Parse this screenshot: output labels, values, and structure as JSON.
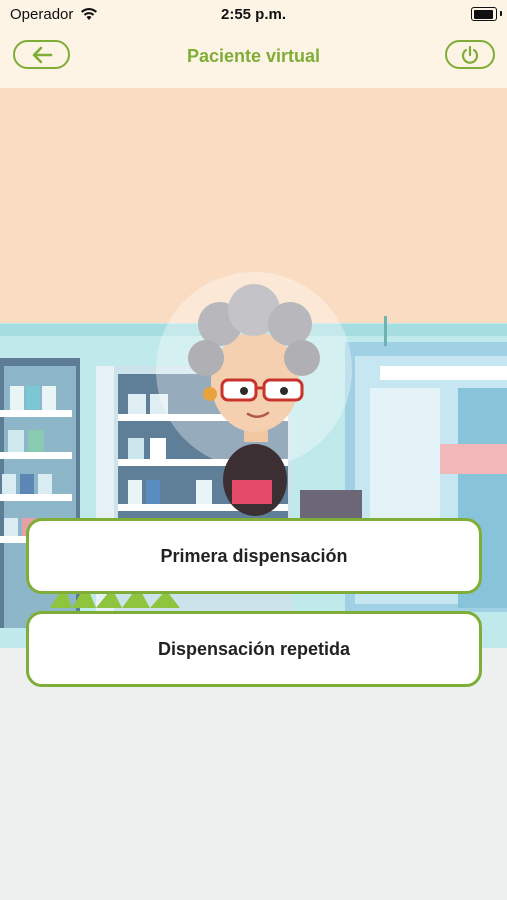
{
  "status_bar": {
    "carrier": "Operador",
    "time": "2:55 p.m."
  },
  "header": {
    "title": "Paciente virtual",
    "back_icon": "arrow-left-icon",
    "power_icon": "power-icon"
  },
  "options": [
    {
      "label": "Primera dispensación"
    },
    {
      "label": "Dispensación repetida"
    }
  ],
  "colors": {
    "accent": "#7fae38",
    "header_bg": "#fdf4e5",
    "page_bg": "#eef0f0"
  }
}
